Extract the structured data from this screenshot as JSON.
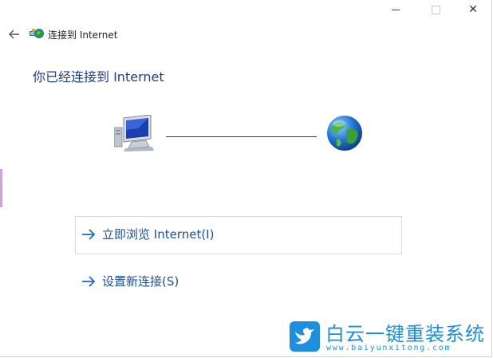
{
  "window": {
    "controls": {
      "minimize": "minimize",
      "maximize": "maximize",
      "close": "✕"
    }
  },
  "nav": {
    "back_icon": "back-arrow-icon",
    "title_icon": "network-globe-icon",
    "title": "连接到 Internet"
  },
  "main": {
    "heading": "你已经连接到 Internet",
    "diagram": {
      "left_icon": "computer-icon",
      "right_icon": "globe-icon"
    },
    "links": [
      {
        "label": "立即浏览 Internet(I)",
        "icon": "arrow-right-icon"
      },
      {
        "label": "设置新连接(S)",
        "icon": "arrow-right-icon"
      }
    ]
  },
  "watermark": {
    "title": "白云一键重装系统",
    "url": "www.baiyunxitong.com",
    "logo_icon": "bird-logo-icon"
  },
  "colors": {
    "heading": "#1d3d8f",
    "link": "#1e4fa0",
    "watermark": "#1e8fe0"
  }
}
